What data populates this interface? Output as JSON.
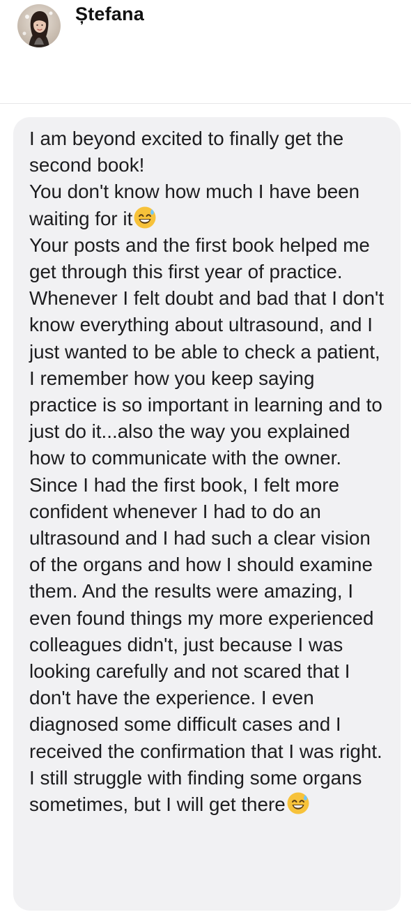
{
  "header": {
    "sender_name": "Ștefana",
    "avatar_icon": "profile-photo-avatar"
  },
  "message": {
    "paragraphs": [
      {
        "text": "I am beyond excited to finally get the second book!",
        "emoji": ""
      },
      {
        "text": "You don't know how much I have been waiting for it",
        "emoji": "grinning-sweat-emoji"
      },
      {
        "text": "Your posts and the first book helped me get through this first year of practice. Whenever I felt doubt and bad that I don't know everything about ultrasound, and I just wanted to be able to check a patient, I remember how you keep saying practice is so important in learning and to just do it...also the way you explained how to communicate with the owner. Since I had the first book, I felt more confident whenever I had to do an ultrasound and I had such a clear vision of the organs and how I should examine them. And the results were amazing, I even found things my more experienced colleagues didn't, just because I was looking carefully and not scared that I don't have the experience. I even diagnosed  some difficult cases and I received the confirmation that I was right. I still struggle with finding some organs sometimes, but I will get there",
        "emoji": "grinning-sweat-emoji"
      }
    ]
  },
  "colors": {
    "bubble_background": "#f1f1f3",
    "text": "#1c1c1e",
    "divider": "#e6e6e8",
    "emoji_face": "#f7c23a",
    "emoji_sweat": "#6fc6ff"
  }
}
